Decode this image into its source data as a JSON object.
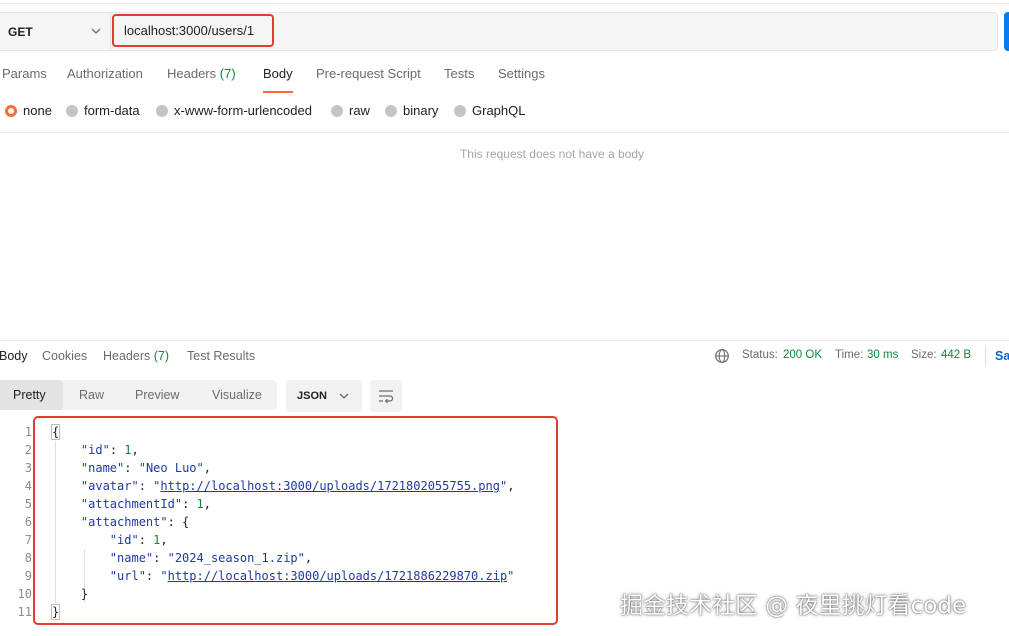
{
  "request": {
    "method": "GET",
    "url": "localhost:3000/users/1"
  },
  "request_tabs": [
    {
      "label": "Params"
    },
    {
      "label": "Authorization"
    },
    {
      "label": "Headers",
      "count": "(7)"
    },
    {
      "label": "Body",
      "active": true
    },
    {
      "label": "Pre-request Script"
    },
    {
      "label": "Tests"
    },
    {
      "label": "Settings"
    }
  ],
  "body_types": [
    {
      "label": "none",
      "selected": true
    },
    {
      "label": "form-data"
    },
    {
      "label": "x-www-form-urlencoded"
    },
    {
      "label": "raw"
    },
    {
      "label": "binary"
    },
    {
      "label": "GraphQL"
    }
  ],
  "no_body_message": "This request does not have a body",
  "response_tabs": [
    {
      "label": "Body",
      "active": true
    },
    {
      "label": "Cookies"
    },
    {
      "label": "Headers",
      "count": "(7)"
    },
    {
      "label": "Test Results"
    }
  ],
  "response_status": {
    "status_label": "Status:",
    "status_value": "200 OK",
    "time_label": "Time:",
    "time_value": "30 ms",
    "size_label": "Size:",
    "size_value": "442 B",
    "save_truncated": "Sa"
  },
  "view_modes": [
    {
      "label": "Pretty",
      "active": true
    },
    {
      "label": "Raw"
    },
    {
      "label": "Preview"
    },
    {
      "label": "Visualize"
    }
  ],
  "format": "JSON",
  "icons": {
    "method_dropdown": "chevron-down-icon",
    "format_dropdown": "chevron-down-icon",
    "wrap": "wrap-lines-icon",
    "network": "globe-icon"
  },
  "colors": {
    "accent": "#ff6c37",
    "highlight_frame": "#e33b2e",
    "success": "#0b8a3c",
    "send": "#097bed"
  },
  "response_json": {
    "line_numbers": [
      "1",
      "2",
      "3",
      "4",
      "5",
      "6",
      "7",
      "8",
      "9",
      "10",
      "11"
    ],
    "id": "1",
    "name": "\"Neo Luo\"",
    "avatar": "http://localhost:3000/uploads/1721802055755.png",
    "attachmentId": "1",
    "attachment": {
      "id": "1",
      "name": "\"2024_season_1.zip\"",
      "url": "http://localhost:3000/uploads/1721886229870.zip"
    }
  },
  "watermark": "掘金技术社区 @ 夜里挑灯看code"
}
